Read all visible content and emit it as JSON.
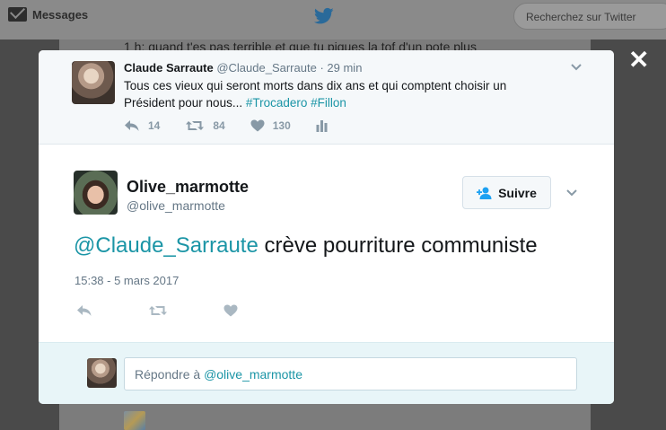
{
  "background": {
    "nav_messages_label": "Messages",
    "search_placeholder": "Recherchez sur Twitter",
    "partial_tweet_text": "1 h: quand t'es pas terrible et que tu piques la tof d'un pote plus"
  },
  "modal": {
    "close_label": "✕",
    "ancestor_tweet": {
      "name": "Claude Sarraute",
      "handle": "@Claude_Sarraute",
      "separator": "·",
      "time": "29 min",
      "text": "Tous ces vieux qui seront morts dans dix ans et qui comptent choisir un Président pour nous...",
      "hashtags": [
        "#Trocadero",
        "#Fillon"
      ],
      "replies": "14",
      "retweets": "84",
      "likes": "130"
    },
    "main_tweet": {
      "name": "Olive_marmotte",
      "handle": "@olive_marmotte",
      "follow_label": "Suivre",
      "mention": "@Claude_Sarraute",
      "text": "crève pourriture communiste",
      "timestamp": "15:38 - 5 mars 2017"
    },
    "reply": {
      "prefix": "Répondre à",
      "mention": "@olive_marmotte"
    }
  },
  "colors": {
    "accent": "#1b95a6",
    "icon_gray": "#8899a6",
    "twitter_blue": "#1da1f2"
  },
  "icons": [
    "mail-icon",
    "twitter-bird-icon",
    "close-icon",
    "chevron-down-icon",
    "reply-icon",
    "retweet-icon",
    "heart-icon",
    "analytics-icon",
    "follow-user-icon"
  ]
}
